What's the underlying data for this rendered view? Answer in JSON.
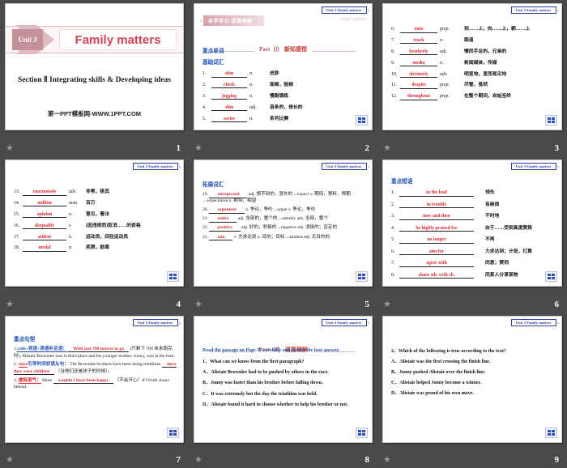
{
  "deck": {
    "unit_tag": "Unit 3  Family matters",
    "badge_name": "grid-badge"
  },
  "slides": [
    {
      "number": "1",
      "unit_label": "Unit 3",
      "title": "Family matters",
      "section": "Section Ⅱ  Integrating skills & Developing ideas",
      "footer": "第一PPT模板网-WWW.1PPT.COM"
    },
    {
      "number": "2",
      "banner": "自学导引·语篇理解",
      "banner_sub": "自主预习·新知导学",
      "part": "Part（Ⅰ）",
      "part_cn": "新知感悟",
      "heading1": "重点单词",
      "heading2": "基础词汇",
      "words": [
        {
          "num": "1.",
          "word": "skin",
          "pos": "n.",
          "meaning": "皮肤"
        },
        {
          "num": "2.",
          "word": "cheek",
          "pos": "n.",
          "meaning": "面颊，脸颊"
        },
        {
          "num": "3.",
          "word": "jogging",
          "pos": "n.",
          "meaning": "慢跑锻炼"
        },
        {
          "num": "4.",
          "word": "slim",
          "pos": "adj.",
          "meaning": "苗条的，修长的"
        },
        {
          "num": "5.",
          "word": "series",
          "pos": "n.",
          "meaning": "系列比赛"
        }
      ]
    },
    {
      "number": "3",
      "words": [
        {
          "num": "6.",
          "word": "onto",
          "pos": "prep.",
          "meaning": "到……上，向……上，朝……上"
        },
        {
          "num": "7.",
          "word": "track",
          "pos": "n.",
          "meaning": "跑道"
        },
        {
          "num": "8.",
          "word": "brotherly",
          "pos": "adj.",
          "meaning": "情同手足的，兄弟的"
        },
        {
          "num": "9.",
          "word": "media",
          "pos": "n.",
          "meaning": "新闻媒体，传媒"
        },
        {
          "num": "10.",
          "word": "obviously",
          "pos": "adv.",
          "meaning": "明显地，显而易见地"
        },
        {
          "num": "11.",
          "word": "despite",
          "pos": "prep.",
          "meaning": "尽管，虽然"
        },
        {
          "num": "12.",
          "word": "throughout",
          "pos": "prep.",
          "meaning": "在整个期间，自始至终"
        }
      ]
    },
    {
      "number": "4",
      "words": [
        {
          "num": "13.",
          "word": "enormously",
          "pos": "adv.",
          "meaning": "非常，极其"
        },
        {
          "num": "14.",
          "word": "million",
          "pos": "num.",
          "meaning": "百万"
        },
        {
          "num": "15.",
          "word": "opinion",
          "pos": "n.",
          "meaning": "意见，看法"
        },
        {
          "num": "16.",
          "word": "disqualify",
          "pos": "v.",
          "meaning": "(因违规而)取消……的资格"
        },
        {
          "num": "17.",
          "word": "athlete",
          "pos": "n.",
          "meaning": "运动员，田径运动员"
        },
        {
          "num": "18.",
          "word": "medal",
          "pos": "n.",
          "meaning": "奖牌，勋章"
        }
      ]
    },
    {
      "number": "5",
      "heading": "拓展词汇",
      "entries": [
        {
          "num": "19.",
          "word": "unexpected",
          "rest": "adj. 想不到的，意外的→expect v. 期待，预料，预期→expectation n. 期待，期望"
        },
        {
          "num": "20.",
          "word": "argument",
          "rest": "n. 争论，争吵→argue v. 争论，争吵"
        },
        {
          "num": "21.",
          "word": "entire",
          "rest": "adj. 全部的，整个的→entirely adv. 全部，整个"
        },
        {
          "num": "22.",
          "word": "positive",
          "rest": "adj. 好的，积极的→negative adj. 消极的；否定的"
        },
        {
          "num": "23.",
          "word": "aim",
          "rest": "v. 力求达到 n. 目的；目标→aimless adj. 无目的的"
        }
      ]
    },
    {
      "number": "6",
      "heading": "重点短语",
      "phrases": [
        {
          "num": "1.",
          "phrase": "in the lead",
          "meaning": "领先"
        },
        {
          "num": "2.",
          "phrase": "in trouble",
          "meaning": "有麻烦"
        },
        {
          "num": "3.",
          "phrase": "now and then",
          "meaning": "不时地"
        },
        {
          "num": "4.",
          "phrase": "be highly praised for",
          "meaning": "由于……受到高度赞扬"
        },
        {
          "num": "5.",
          "phrase": "no longer",
          "meaning": "不再"
        },
        {
          "num": "6.",
          "phrase": "aim for",
          "meaning": "力求达到；计划，打算"
        },
        {
          "num": "7.",
          "phrase": "agree with",
          "meaning": "同意；赞同"
        },
        {
          "num": "8.",
          "phrase": "share sth. with sb.",
          "meaning": "同某人分享某物"
        }
      ]
    },
    {
      "number": "7",
      "heading": "重点句型",
      "sentences": [
        {
          "num": "1.",
          "pattern": "with+宾语+宾语补足语：",
          "answer": "With just 700 metres to go",
          "tail": "(只剩下 700 米未跑完时), Alistair Brownlee was in third place and his younger brother, Jonny, was in the lead."
        },
        {
          "num": "2.",
          "key": "since",
          "pattern": "引导时间状语从句：",
          "lead": "The Brownlee brothers have been doing triathlons",
          "answer": "since they were children",
          "tail": "（当他们还是孩子的时候）。"
        },
        {
          "num": "3.",
          "pattern": "虚拟语气：",
          "lead": "Mum",
          "answer": "wouldn't have been happy",
          "tail": "（不会开心）if I'd left Jonny behind."
        }
      ]
    },
    {
      "number": "8",
      "part": "Part（Ⅱ）",
      "part_cn": "语篇理解",
      "intro": "Read the passage on Page 32 carefully and choose the best answer.",
      "question": "1．What can we know from the first paragraph?",
      "options": [
        "A．Alistair Brownlee had to be pushed by others in the race.",
        "B．Jonny was faster than his brother before falling down.",
        "C．It was extremely hot the day the triathlon was held.",
        "D．Alistair found it hard to choose whether to help his brother or not."
      ]
    },
    {
      "number": "9",
      "question": "2．Which of the following is true according to the text?",
      "options": [
        "A．Alistair was the first crossing the finish line.",
        "B．Jonny pushed Alistair over the finish line.",
        "C．Alistair helped Jonny become a winner.",
        "D．Alistair was proud of his own move."
      ]
    }
  ]
}
